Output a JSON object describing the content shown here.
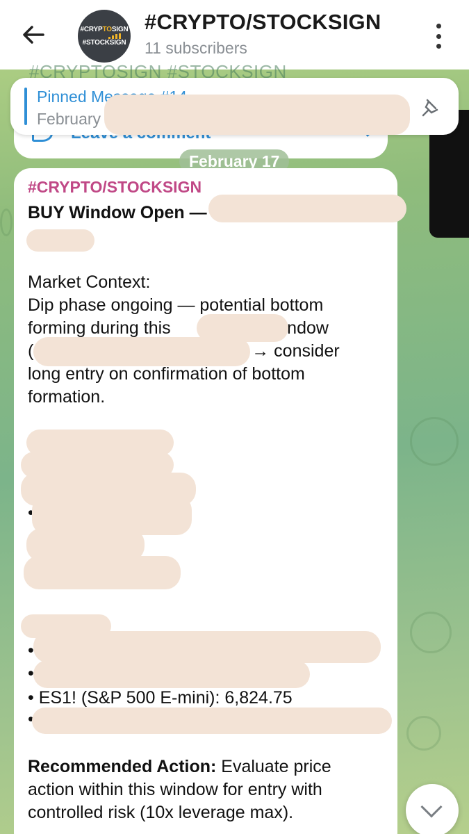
{
  "header": {
    "title": "#CRYPTO/STOCKSIGN",
    "subtitle": "11 subscribers",
    "avatar_line1_a": "#CRYP",
    "avatar_line1_b": "TO",
    "avatar_line1_c": "SIGN",
    "avatar_line2": "#STOCKSIGN"
  },
  "background_message": {
    "ghost_text": "#CRYPTOSIGN #STOCKSIGN",
    "comment_label": "Leave a comment"
  },
  "pinned": {
    "title": "Pinned Message #14",
    "date": "February"
  },
  "date_separator": "February 17",
  "message": {
    "channel": "#CRYPTO/STOCKSIGN",
    "headline": "BUY Window Open —",
    "context_label": "Market Context:",
    "line1": "Dip phase ongoing — potential bottom",
    "line2_a": "forming during this",
    "line2_b": "window",
    "line3_a": "(",
    "line3_b": "→ consider",
    "line4": "long entry on confirmation of bottom",
    "line5": "formation.",
    "bullet_char": "•",
    "es_line": "• ES1! (S&P 500 E-mini): 6,824.75",
    "action_label": "Recommended Action:",
    "action_text_1": " Evaluate price",
    "action_text_2": "action within this window for entry with",
    "action_text_3": "controlled risk (10x leverage max)."
  },
  "colors": {
    "accent_blue": "#2f8fd6",
    "channel_pink": "#c04886",
    "redaction": "#f3e3d6"
  },
  "icons": [
    "back-arrow-icon",
    "more-vertical-icon",
    "pin-icon",
    "comment-icon",
    "chevron-right-icon",
    "chevron-down-icon"
  ]
}
